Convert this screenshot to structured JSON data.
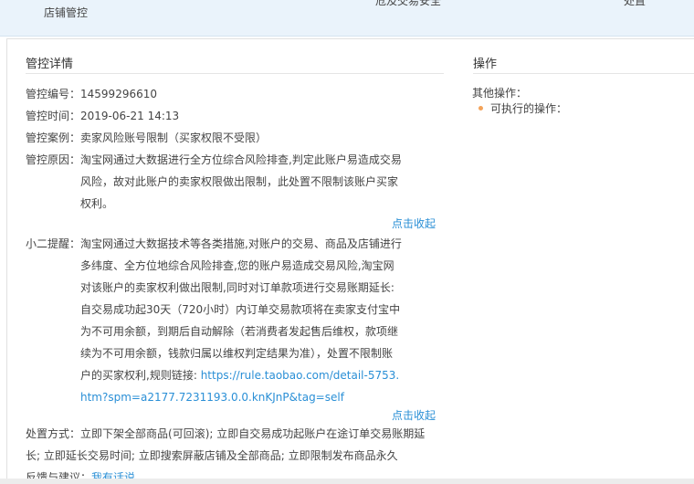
{
  "top_bar": {
    "col1": "店铺管控",
    "col2": "危及交易安全",
    "col3": "处置"
  },
  "detail": {
    "section_title": "管控详情",
    "id_label": "管控编号：",
    "id_value": "14599296610",
    "time_label": "管控时间：",
    "time_value": "2019-06-21 14:13",
    "case_label": "管控案例：",
    "case_value": "卖家风险账号限制（买家权限不受限）",
    "reason_label": "管控原因：",
    "reason_value": "淘宝网通过大数据进行全方位综合风险排查,判定此账户易造成交易风险，故对此账户的卖家权限做出限制，此处置不限制该账户买家权利。",
    "collapse_1": "点击收起",
    "tip_label": "小二提醒：",
    "tip_value": "淘宝网通过大数据技术等各类措施,对账户的交易、商品及店铺进行多纬度、全方位地综合风险排查,您的账户易造成交易风险,淘宝网对该账户的卖家权利做出限制,同时对订单款项进行交易账期延长:自交易成功起30天（720小时）内订单交易款项将在卖家支付宝中为不可用余额，到期后自动解除（若消费者发起售后维权，款项继续为不可用余额，钱款归属以维权判定结果为准），处置不限制账户的买家权利,规则链接: ",
    "tip_link": "https://rule.taobao.com/detail-5753.htm?spm=a2177.7231193.0.0.knKJnP&tag=self",
    "collapse_2": "点击收起",
    "action_label": "处置方式：",
    "action_value": "立即下架全部商品(可回滚); 立即自交易成功起账户在途订单交易账期延长; 立即延长交易时间; 立即搜索屏蔽店铺及全部商品; 立即限制发布商品永久",
    "feedback_label": "反馈与建议：",
    "feedback_link": "我有话说"
  },
  "operations": {
    "section_title": "操作",
    "other_ops_label": "其他操作：",
    "executable_label": "可执行的操作："
  },
  "colors": {
    "link": "#2a8fd6",
    "bullet": "#f3a35a",
    "top_bar_bg": "#eaf3fb"
  }
}
